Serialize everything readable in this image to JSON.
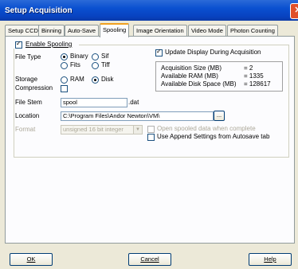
{
  "window": {
    "title": "Setup Acquisition",
    "close_glyph": "✕"
  },
  "tabs": [
    {
      "label": "Setup CCD"
    },
    {
      "label": "Binning"
    },
    {
      "label": "Auto-Save"
    },
    {
      "label": "Spooling",
      "active": true
    },
    {
      "label": "Image Orientation"
    },
    {
      "label": "Video Mode"
    },
    {
      "label": "Photon Counting"
    }
  ],
  "spooling": {
    "enable_label": "Enable Spooling",
    "enable_checked": true,
    "file_type": {
      "label": "File Type",
      "options": [
        "Binary",
        "Sif",
        "Fits",
        "Tiff"
      ],
      "selected": "Binary"
    },
    "storage": {
      "label": "Storage",
      "options": [
        "RAM",
        "Disk"
      ],
      "selected": "Disk"
    },
    "compression": {
      "label": "Compression",
      "checked": false
    },
    "update_display": {
      "label": "Update Display During Acquisition",
      "checked": true
    },
    "info": {
      "rows": [
        {
          "label": "Acquisition Size (MB)",
          "value": "= 2"
        },
        {
          "label": "Available RAM (MB)",
          "value": "= 1335"
        },
        {
          "label": "Available Disk Space (MB)",
          "value": "= 128617"
        }
      ]
    },
    "file_stem": {
      "label": "File Stem",
      "value": "spool",
      "suffix": ".dat"
    },
    "location": {
      "label": "Location",
      "value": "C:\\Program Files\\Andor Newton\\VM\\",
      "browse_label": "..."
    },
    "format": {
      "label": "Format",
      "value": "unsigned 16 bit integer"
    },
    "open_spooled": {
      "label": "Open spooled data when complete",
      "checked": false
    },
    "append_settings": {
      "label": "Use Append Settings from Autosave tab",
      "checked": false
    }
  },
  "footer": {
    "ok_label": "OK",
    "cancel_label": "Cancel",
    "help_label": "Help"
  },
  "colors": {
    "titlebar": "#0a50d0",
    "tab_highlight": "#f0a020",
    "panel": "#fcfcfe",
    "window": "#ece9d8"
  }
}
